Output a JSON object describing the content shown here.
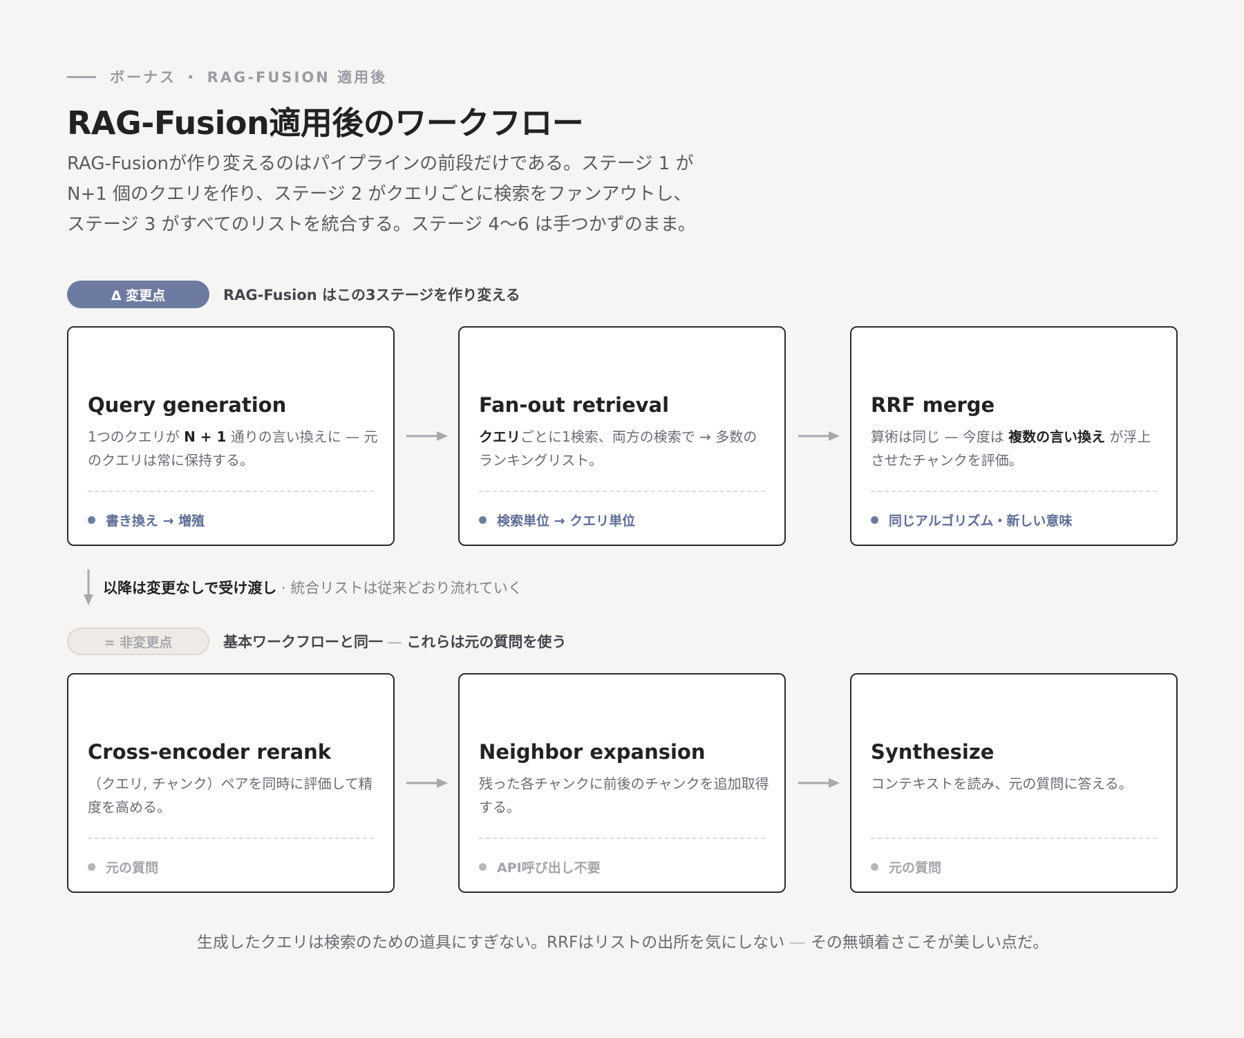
{
  "header": {
    "eyebrow": "ボーナス ・ RAG-FUSION 適用後",
    "title": "RAG-Fusion適用後のワークフロー",
    "intro_lines": [
      "RAG-Fusionが作り変えるのはパイプラインの前段だけである。ステージ 1 が",
      "N+1 個のクエリを作り、ステージ 2 がクエリごとに検索をファンアウトし、",
      "ステージ 3 がすべてのリストを統合する。ステージ 4〜6 は手つかずのまま。"
    ]
  },
  "changed_section": {
    "pill": "Δ 変更点",
    "note": "RAG-Fusion はこの3ステージを作り変える",
    "cards": [
      {
        "title": "Query generation",
        "desc_pre": "1つのクエリが ",
        "desc_bold": "N + 1",
        "desc_post": " 通りの言い換えに — 元のクエリは常に保持する。",
        "tag": "書き換え → 増殖"
      },
      {
        "title": "Fan-out retrieval",
        "desc_pre": "",
        "desc_bold": "クエリ",
        "desc_post": "ごとに1検索、両方の検索で → 多数のランキングリスト。",
        "tag": "検索単位 → クエリ単位"
      },
      {
        "title": "RRF merge",
        "desc_pre": "算術は同じ — 今度は ",
        "desc_bold": "複数の言い換え",
        "desc_post": " が浮上させたチャンクを評価。",
        "tag": "同じアルゴリズム・新しい意味"
      }
    ]
  },
  "handoff": {
    "strong": "以降は変更なしで受け渡し",
    "weak": " · 統合リストは従来どおり流れていく"
  },
  "unchanged_section": {
    "pill": "= 非変更点",
    "note_main": "基本ワークフローと同一",
    "note_dash": " — ",
    "note_tail": "これらは元の質問を使う",
    "cards": [
      {
        "title": "Cross-encoder rerank",
        "desc": "（クエリ, チャンク）ペアを同時に評価して精度を高める。",
        "tag": "元の質問"
      },
      {
        "title": "Neighbor expansion",
        "desc": "残った各チャンクに前後のチャンクを追加取得する。",
        "tag": "API呼び出し不要"
      },
      {
        "title": "Synthesize",
        "desc": "コンテキストを読み、元の質問に答える。",
        "tag": "元の質問"
      }
    ]
  },
  "footer": {
    "main": "生成したクエリは検索のための道具にすぎない。RRFはリストの出所を気にしない",
    "dash": " — ",
    "tail": "その無頓着さこそが美しい点だ。"
  },
  "colors": {
    "accent": "#6e7ba0",
    "background": "#f6f5f3",
    "card_border": "#2a2a2a",
    "arrow": "#a8a8ad"
  }
}
